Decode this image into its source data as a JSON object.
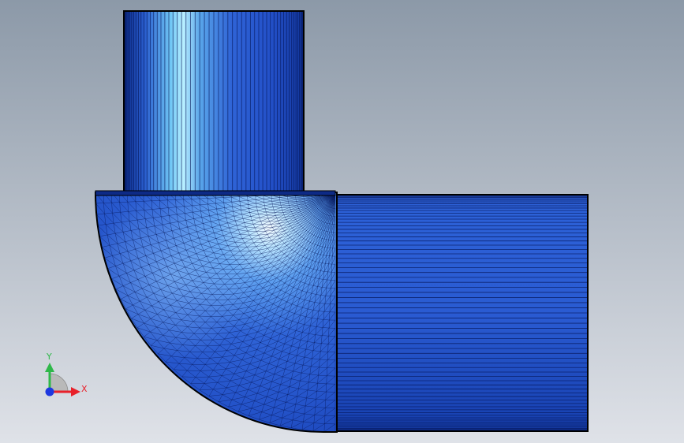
{
  "viewport": {
    "background_top": "#8c99a8",
    "background_bottom": "#dfe2e8"
  },
  "model": {
    "name": "pipe-elbow",
    "mesh_color": "#2f63d6",
    "mesh_dark": "#0b2f9a",
    "mesh_light": "#a9e6ff",
    "edge_color": "#000000"
  },
  "triad": {
    "x_label": "X",
    "y_label": "Y",
    "x_color": "#e8202a",
    "y_color": "#2fb84a",
    "z_color": "#1e38e0"
  }
}
